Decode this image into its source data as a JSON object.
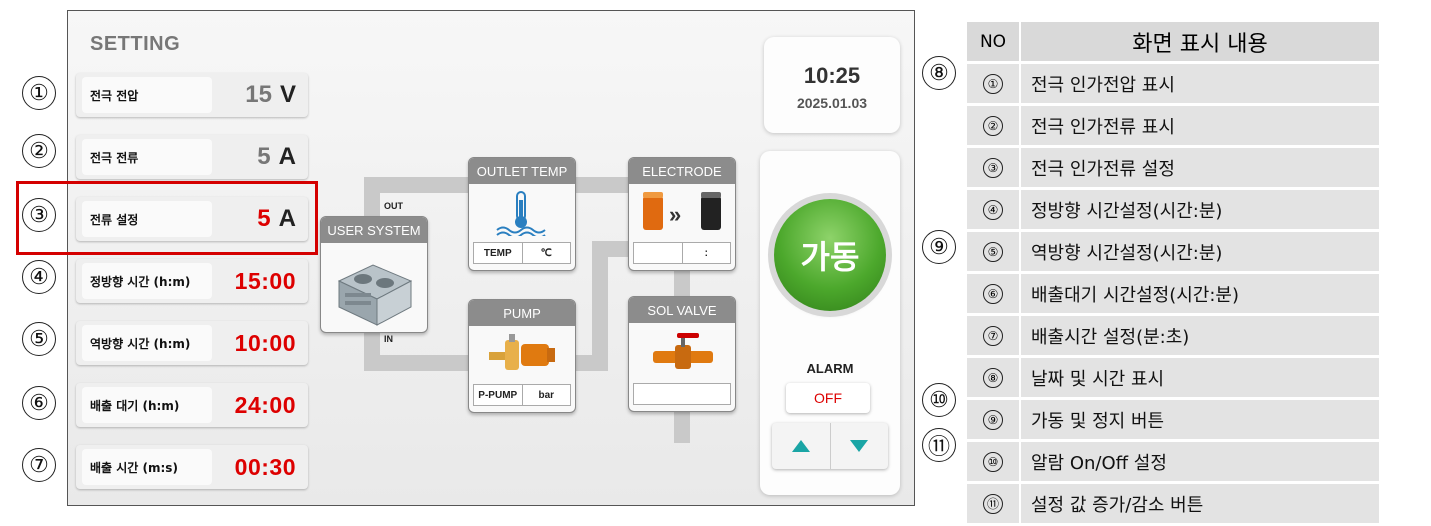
{
  "left_callouts": [
    "①",
    "②",
    "③",
    "④",
    "⑤",
    "⑥",
    "⑦"
  ],
  "middle_callouts": [
    "⑧",
    "⑨",
    "⑩",
    "⑪"
  ],
  "hmi": {
    "title": "SETTING",
    "rows": [
      {
        "label": "전극 전압",
        "value": "15",
        "unit": "V"
      },
      {
        "label": "전극 전류",
        "value": "5",
        "unit": "A"
      },
      {
        "label": "전류 설정",
        "value": "5",
        "unit": "A"
      },
      {
        "label": "정방향 시간 (h:m)",
        "value": "15:00"
      },
      {
        "label": "역방향 시간 (h:m)",
        "value": "10:00"
      },
      {
        "label": "배출 대기 (h:m)",
        "value": "24:00"
      },
      {
        "label": "배출 시간 (m:s)",
        "value": "00:30"
      }
    ],
    "diagram": {
      "user_system": "USER SYSTEM",
      "out": "OUT",
      "in": "IN",
      "outlet_temp": {
        "title": "OUTLET TEMP",
        "cell1": "TEMP",
        "cell2": "℃"
      },
      "electrode": {
        "title": "ELECTRODE",
        "cell1": "",
        "cell2": ":"
      },
      "pump": {
        "title": "PUMP",
        "cell1": "P-PUMP",
        "cell2": "bar"
      },
      "sol_valve": {
        "title": "SOL VALVE"
      }
    },
    "clock": {
      "time": "10:25",
      "date": "2025.01.03"
    },
    "run_button": "가동",
    "alarm": {
      "label": "ALARM",
      "state": "OFF"
    }
  },
  "table": {
    "header": {
      "no": "NO",
      "content": "화면 표시 내용"
    },
    "rows": [
      {
        "no": "①",
        "text": "전극 인가전압 표시"
      },
      {
        "no": "②",
        "text": "전극 인가전류 표시"
      },
      {
        "no": "③",
        "text": "전극 인가전류 설정"
      },
      {
        "no": "④",
        "text": "정방향 시간설정(시간:분)"
      },
      {
        "no": "⑤",
        "text": "역방향 시간설정(시간:분)"
      },
      {
        "no": "⑥",
        "text": "배출대기 시간설정(시간:분)"
      },
      {
        "no": "⑦",
        "text": "배출시간 설정(분:초)"
      },
      {
        "no": "⑧",
        "text": "날짜 및 시간 표시"
      },
      {
        "no": "⑨",
        "text": "가동 및 정지 버튼"
      },
      {
        "no": "⑩",
        "text": "알람 On/Off 설정"
      },
      {
        "no": "⑪",
        "text": "설정 값 증가/감소 버튼"
      }
    ]
  }
}
